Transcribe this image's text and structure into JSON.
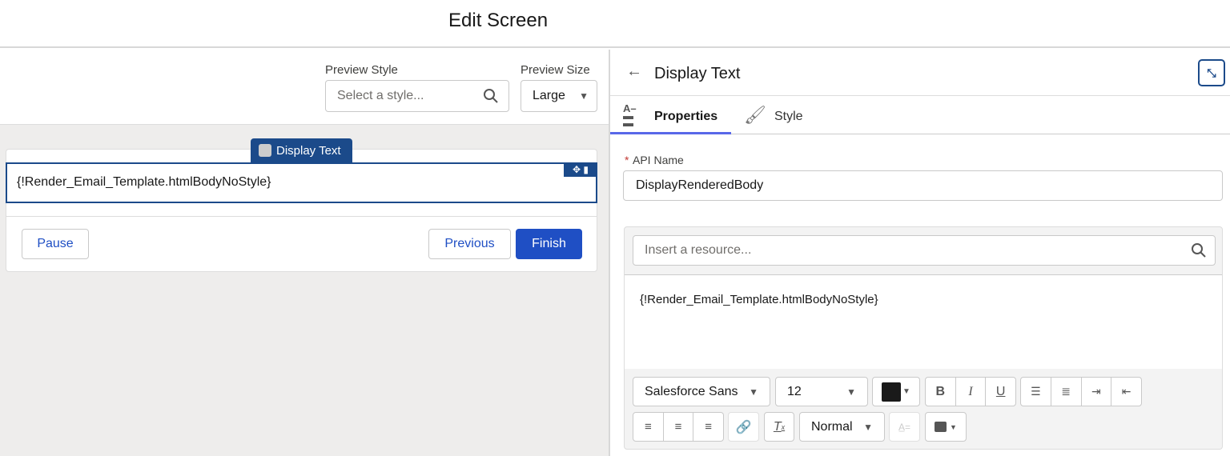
{
  "header": {
    "title": "Edit Screen"
  },
  "preview": {
    "style_label": "Preview Style",
    "style_placeholder": "Select a style...",
    "size_label": "Preview Size",
    "size_value": "Large"
  },
  "canvas": {
    "component_tab": "Display Text",
    "component_value": "{!Render_Email_Template.htmlBodyNoStyle}",
    "move_icon": "✥",
    "delete_icon": "🗑",
    "pause": "Pause",
    "previous": "Previous",
    "finish": "Finish"
  },
  "panel": {
    "title": "Display Text",
    "tabs": [
      {
        "label": "Properties"
      },
      {
        "label": "Style"
      }
    ],
    "api_name_label": "API Name",
    "required": "*",
    "api_name_value": "DisplayRenderedBody",
    "resource_placeholder": "Insert a resource...",
    "editor_content": "{!Render_Email_Template.htmlBodyNoStyle}"
  },
  "toolbar": {
    "font": "Salesforce Sans",
    "size": "12",
    "bold": "B",
    "italic": "I",
    "underline": "U",
    "format": "Normal",
    "text_color": "#1a1a1a"
  },
  "colors": {
    "brand": "#1b4a8a",
    "button": "#1f4fc4",
    "tab_underline": "#5867e8"
  }
}
